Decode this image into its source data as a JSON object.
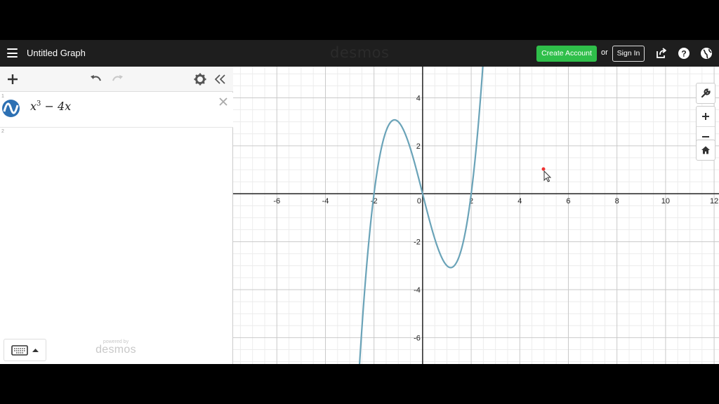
{
  "header": {
    "title": "Untitled Graph",
    "brand": "desmos",
    "create_account": "Create Account",
    "or": "or",
    "sign_in": "Sign In",
    "icons": [
      "menu-icon",
      "share-icon",
      "help-icon",
      "globe-icon"
    ]
  },
  "panel": {
    "toolbar_icons": [
      "add-icon",
      "undo-icon",
      "redo-icon",
      "gear-icon",
      "collapse-icon"
    ],
    "expressions": [
      {
        "number": "1",
        "latex_base": "x",
        "latex_exp": "3",
        "latex_rest": " − 4x",
        "color": "#2d70b3"
      },
      {
        "number": "2"
      }
    ],
    "powered_by": "powered by",
    "powered_brand": "desmos"
  },
  "graph": {
    "x_ticks": [
      "-6",
      "-4",
      "-2",
      "0",
      "2",
      "4",
      "6",
      "8",
      "10",
      "12"
    ],
    "y_ticks": [
      "4",
      "2",
      "-2",
      "-4",
      "-6"
    ],
    "tools": [
      "wrench-icon",
      "zoom-in-icon",
      "zoom-out-icon",
      "home-icon"
    ],
    "curve_color": "#6aa3b8"
  },
  "chart_data": {
    "type": "line",
    "series": [
      {
        "name": "x^3 − 4x",
        "function": "x^3 - 4x"
      }
    ],
    "xlim": [
      -7.8,
      12.2
    ],
    "ylim": [
      -7.1,
      5.3
    ],
    "grid": true,
    "x_tick_labels": [
      "-6",
      "-4",
      "-2",
      "0",
      "2",
      "4",
      "6",
      "8",
      "10",
      "12"
    ],
    "y_tick_labels": [
      "4",
      "2",
      "-2",
      "-4",
      "-6"
    ]
  }
}
